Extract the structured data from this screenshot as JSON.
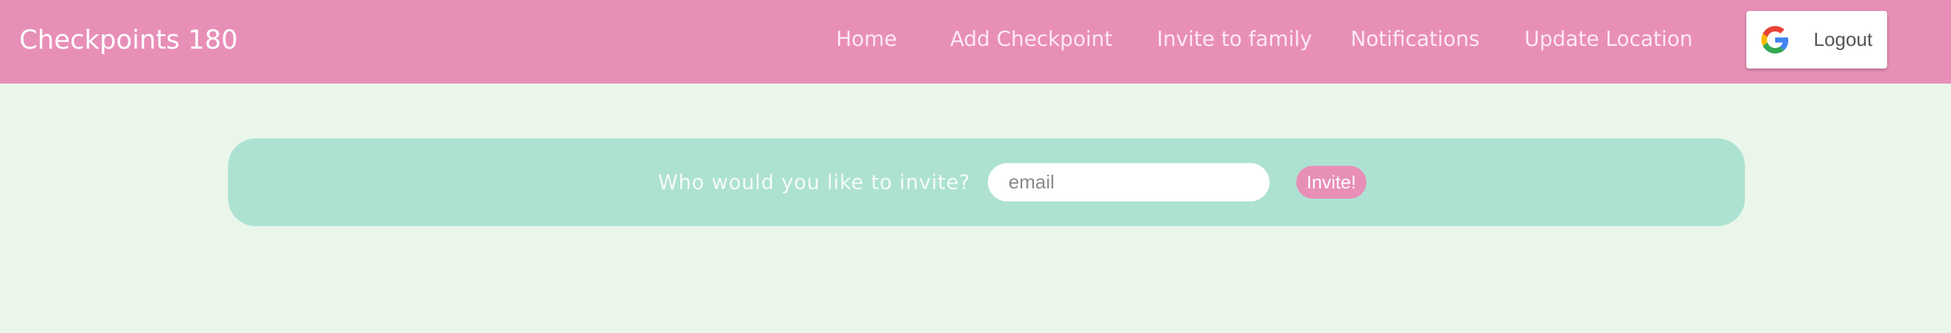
{
  "navbar": {
    "brand": "Checkpoints 180",
    "links": [
      {
        "label": "Home"
      },
      {
        "label": "Add Checkpoint"
      },
      {
        "label": "Invite to family"
      },
      {
        "label": "Notifications"
      },
      {
        "label": "Update Location"
      }
    ],
    "logout": {
      "label": "Logout",
      "icon": "google-icon"
    }
  },
  "invite": {
    "prompt": "Who would you like to invite?",
    "email_placeholder": "email",
    "email_value": "",
    "button_label": "Invite!"
  },
  "colors": {
    "navbar_bg": "#e88fb8",
    "page_bg": "#eaf6ea",
    "panel_bg": "#ade2d2",
    "accent": "#e88fb8"
  }
}
